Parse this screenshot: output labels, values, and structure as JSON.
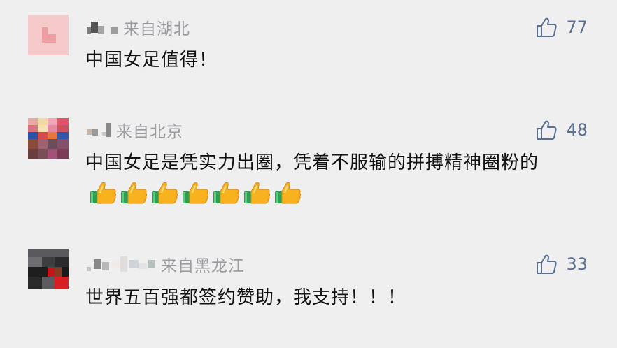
{
  "comments": [
    {
      "location": "来自湖北",
      "likes": "77",
      "text": "中国女足值得！"
    },
    {
      "location": "来自北京",
      "likes": "48",
      "text": "中国女足是凭实力出圈，凭着不服输的拼搏精神圈粉的",
      "emoji": [
        "thumbs-up",
        "thumbs-up",
        "thumbs-up",
        "thumbs-up",
        "thumbs-up",
        "thumbs-up",
        "thumbs-up"
      ]
    },
    {
      "location": "来自黑龙江",
      "likes": "33",
      "text": "世界五百强都签约赞助，我支持！！！"
    }
  ],
  "colors": {
    "background": "#efeff0",
    "location_text": "#9a9a9f",
    "like_accent": "#5b6f92",
    "body_text": "#111111"
  }
}
